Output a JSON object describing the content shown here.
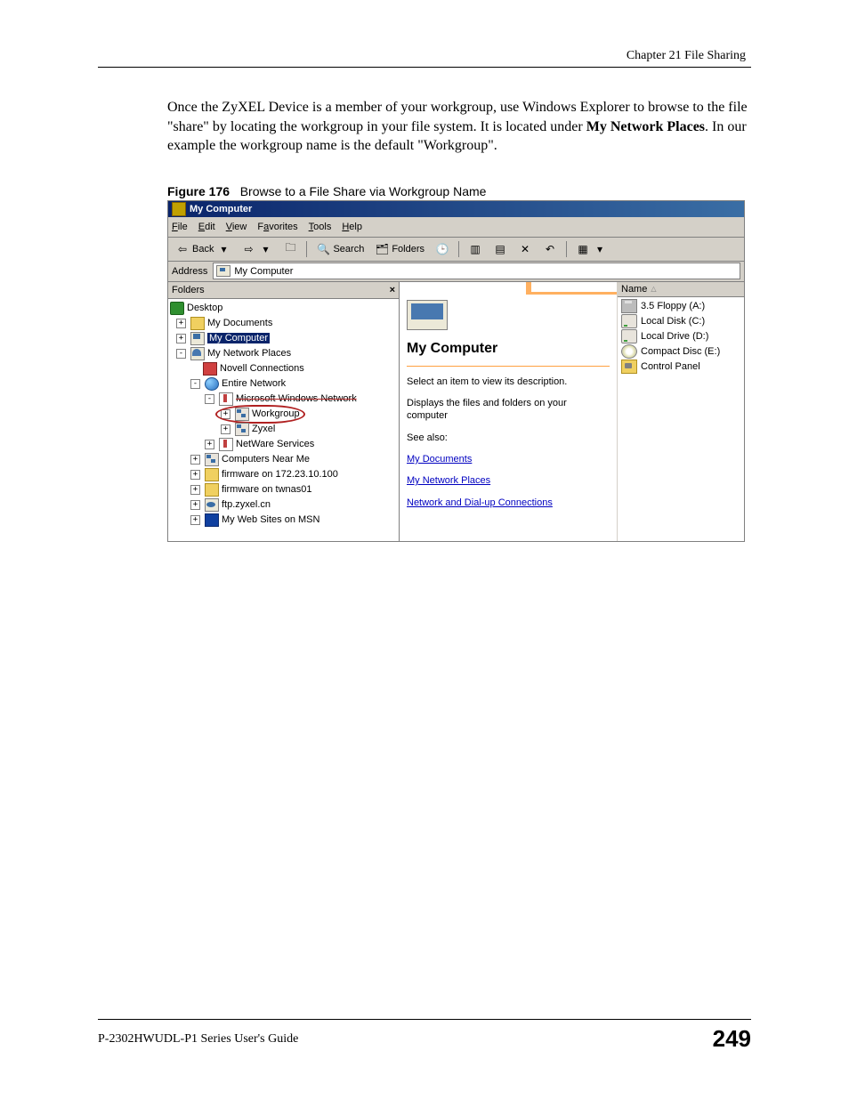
{
  "chapter_header": "Chapter 21 File Sharing",
  "body_text_before": "Once the ZyXEL Device is a member of your workgroup, use Windows Explorer to browse to the file \"share\" by locating the workgroup in your file system. It is located under ",
  "body_bold": "My Network Places",
  "body_text_after": ". In our example the workgroup name is the default \"Workgroup\".",
  "figure_label": "Figure 176",
  "figure_caption": "Browse to a File Share via Workgroup Name",
  "window": {
    "title": "My Computer",
    "menu": {
      "file": "File",
      "edit": "Edit",
      "view": "View",
      "favorites": "Favorites",
      "tools": "Tools",
      "help": "Help"
    },
    "toolbar": {
      "back": "Back",
      "search": "Search",
      "folders": "Folders"
    },
    "address_label": "Address",
    "address_value": "My Computer",
    "folders_header": "Folders",
    "close_x": "×",
    "tree": {
      "desktop": "Desktop",
      "mydocs": "My Documents",
      "mycomp": "My Computer",
      "mynet": "My Network Places",
      "novell": "Novell Connections",
      "entire": "Entire Network",
      "mswin": "Microsoft Windows Network",
      "workgroup": "Workgroup",
      "zyxel": "Zyxel",
      "netware": "NetWare Services",
      "near": "Computers Near Me",
      "fw1": "firmware on 172.23.10.100",
      "fw2": "firmware on twnas01",
      "ftp": "ftp.zyxel.cn",
      "msn": "My Web Sites on MSN"
    },
    "details": {
      "title": "My Computer",
      "select_hint": "Select an item to view its description.",
      "displays": "Displays the files and folders on your computer",
      "see_also": "See also:",
      "mydocs": "My Documents",
      "mynet": "My Network Places",
      "dialup": "Network and Dial-up Connections"
    },
    "name_col": "Name",
    "drives": {
      "floppy": "3.5 Floppy (A:)",
      "localc": "Local Disk (C:)",
      "locald": "Local Drive (D:)",
      "cd": "Compact Disc (E:)",
      "cp": "Control Panel"
    }
  },
  "footer_left": "P-2302HWUDL-P1 Series User's Guide",
  "footer_page": "249"
}
